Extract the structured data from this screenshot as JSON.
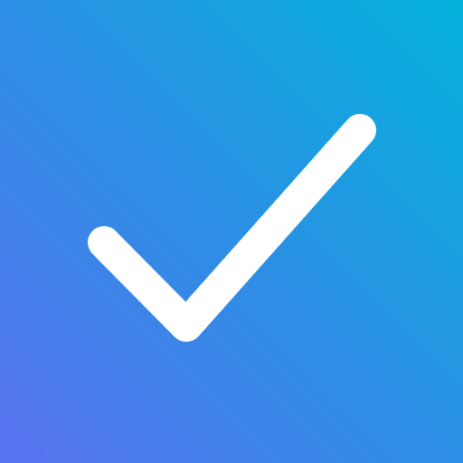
{
  "icon": {
    "name": "checkmark-icon",
    "gradient_start": "#5a72f0",
    "gradient_mid": "#2b8fe4",
    "gradient_end": "#04b3dc",
    "stroke_color": "#ffffff"
  }
}
